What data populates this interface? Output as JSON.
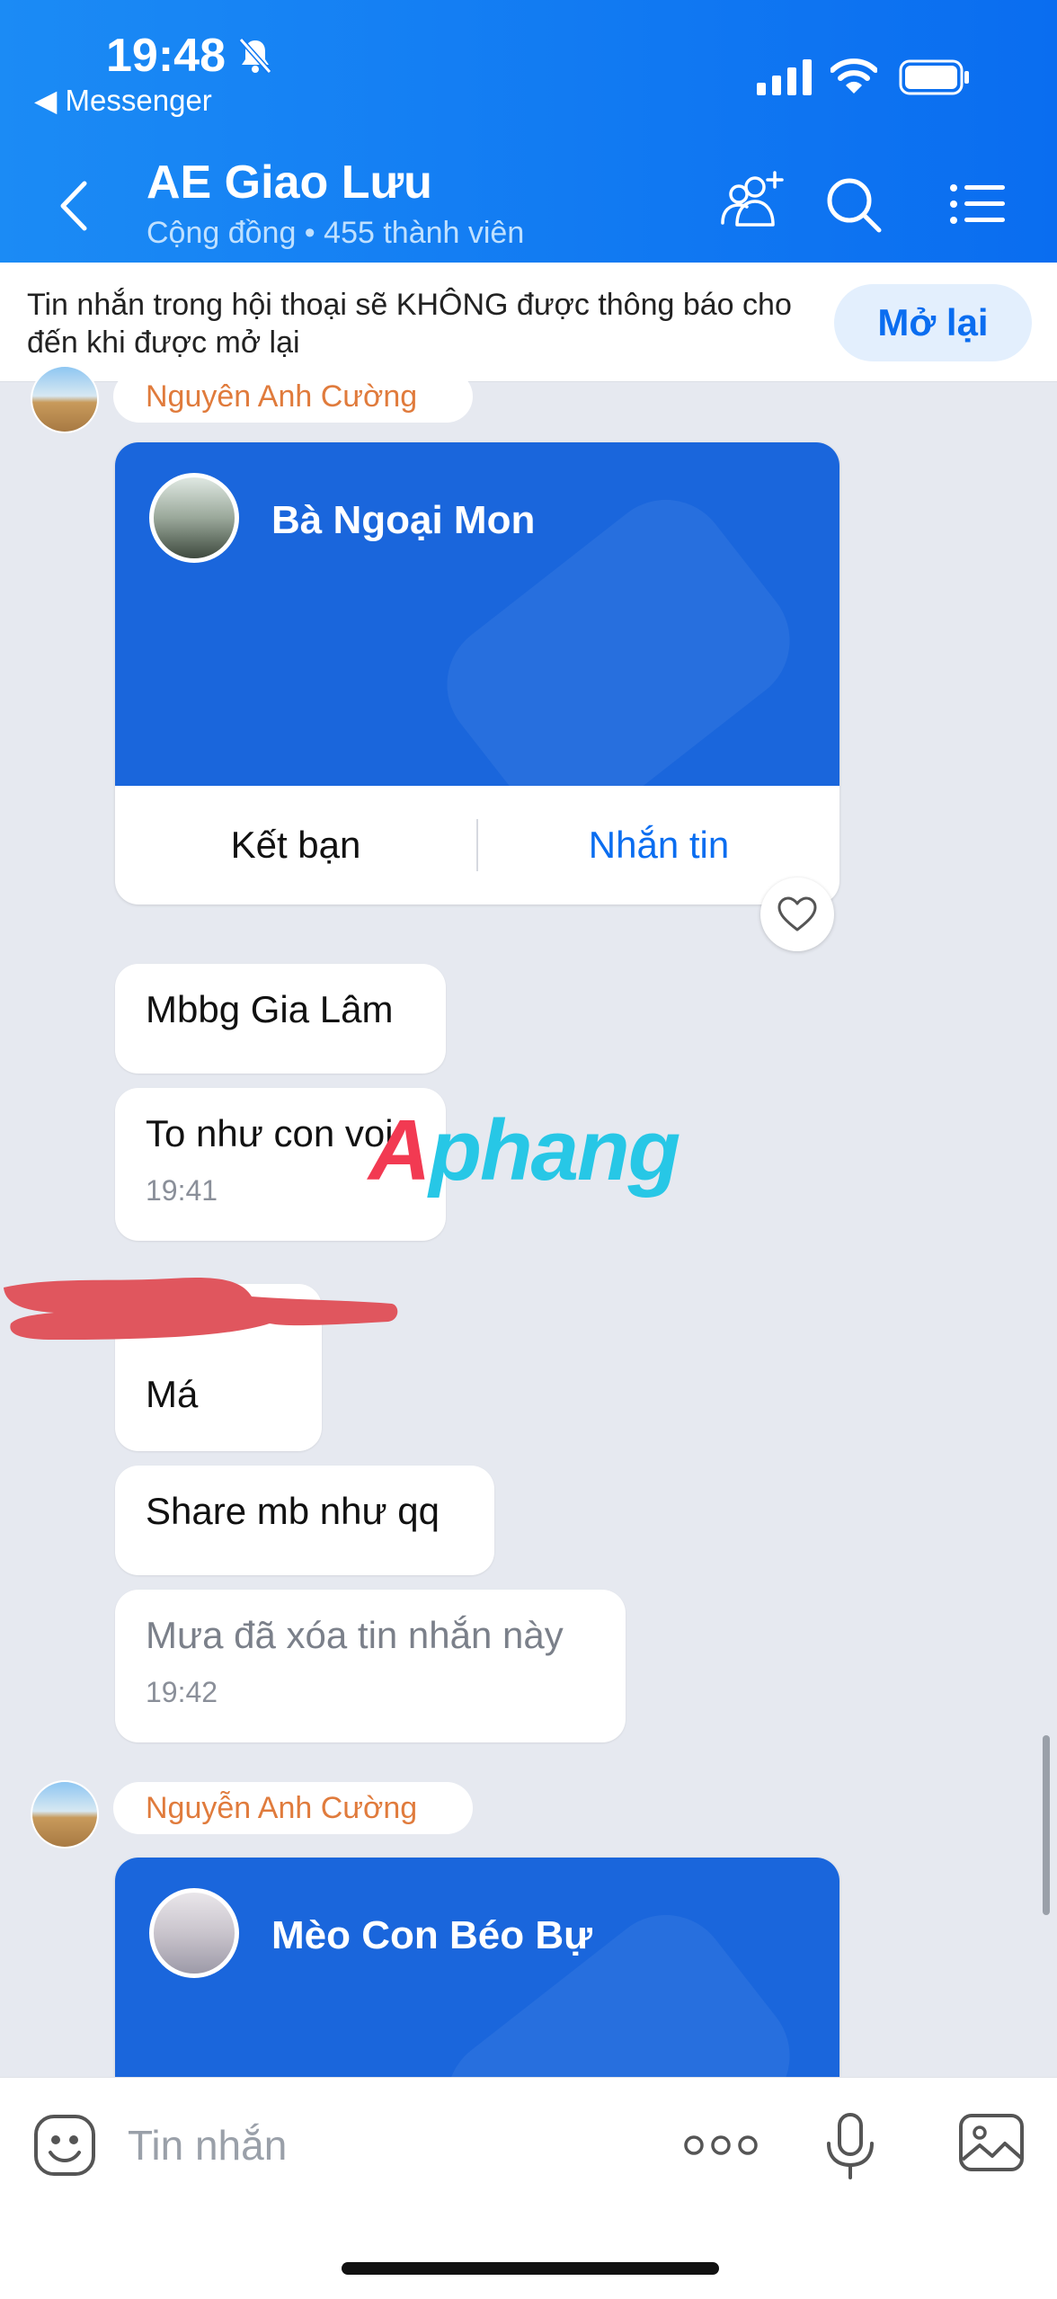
{
  "status_bar": {
    "time": "19:48",
    "back_app": "◀ Messenger"
  },
  "header": {
    "title": "AE Giao Lưu",
    "subtitle": "Cộng đồng • 455 thành viên"
  },
  "notice": {
    "text": "Tin nhắn trong hội thoại sẽ KHÔNG được thông báo cho đến khi được mở lại",
    "button": "Mở lại"
  },
  "messages": {
    "sender_1": "Nguyên Anh Cường",
    "card_1": {
      "name": "Bà Ngoại Mon",
      "add_friend": "Kết bạn",
      "message": "Nhắn tin"
    },
    "m1": "Mbbg Gia Lâm",
    "m2": "To như con voi",
    "m2_time": "19:41",
    "m3": "Má",
    "m4": "Share mb như qq",
    "m5": "Mưa đã xóa tin nhắn này",
    "m5_time": "19:42",
    "sender_2": "Nguyễn Anh Cường",
    "card_2": {
      "name": "Mèo Con Béo Bự"
    }
  },
  "watermark": {
    "first": "A",
    "rest": "phang"
  },
  "input": {
    "placeholder": "Tin nhắn"
  },
  "colors": {
    "header_blue": "#0a6df0",
    "card_blue": "#1a66dc",
    "sender_orange": "#e07b3c"
  },
  "icons": [
    "bell-off-icon",
    "signal-icon",
    "wifi-icon",
    "battery-icon",
    "back-icon",
    "add-member-icon",
    "search-icon",
    "menu-icon",
    "heart-icon",
    "emoji-icon",
    "more-icon",
    "mic-icon",
    "gallery-icon"
  ]
}
